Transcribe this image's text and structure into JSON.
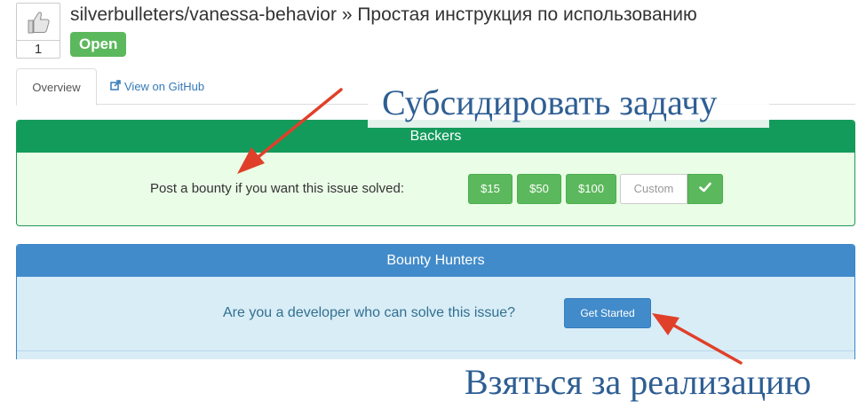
{
  "issue": {
    "vote_count": "1",
    "title": "silverbulleters/vanessa-behavior » Простая инструкция по использованию",
    "status": "Open"
  },
  "tabs": [
    {
      "label": "Overview",
      "active": true
    },
    {
      "label": "View on GitHub",
      "icon": "external-link-icon"
    }
  ],
  "backers": {
    "heading": "Backers",
    "prompt": "Post a bounty if you want this issue solved:",
    "amounts": [
      "$15",
      "$50",
      "$100"
    ],
    "custom_placeholder": "Custom",
    "confirm_icon": "check-icon"
  },
  "hunters": {
    "heading": "Bounty Hunters",
    "prompt": "Are you a developer who can solve this issue?",
    "button": "Get Started"
  },
  "annotations": {
    "top": "Субсидировать задачу",
    "bottom": "Взяться за реализацию",
    "color": "#2e5e93",
    "arrow_color": "#e0402a"
  },
  "colors": {
    "backers_header": "#139b5c",
    "backers_body": "#eafde7",
    "hunters_header": "#428bca",
    "hunters_body": "#d9edf7",
    "success": "#5cb85c",
    "link": "#337ab7"
  }
}
